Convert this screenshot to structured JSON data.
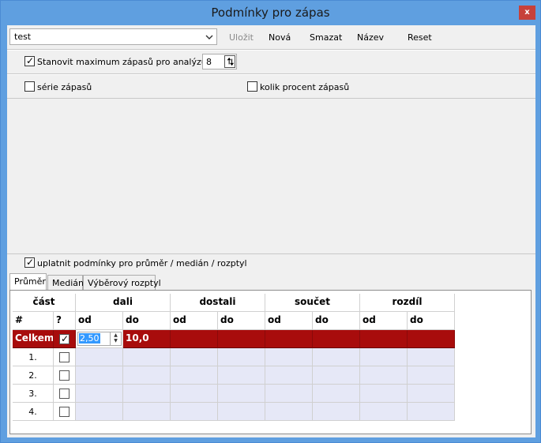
{
  "window": {
    "title": "Podmínky pro zápas",
    "close": "x"
  },
  "toolbar": {
    "combo_value": "test",
    "save": "Uložit",
    "new": "Nová",
    "delete": "Smazat",
    "name": "Název",
    "reset": "Reset"
  },
  "options": {
    "max_matches_label": "Stanovit maximum zápasů pro analýzu",
    "max_matches_checked": true,
    "max_matches_value": "8",
    "series_label": "série zápasů",
    "series_checked": false,
    "percent_label": "kolik procent zápasů",
    "percent_checked": false
  },
  "lower": {
    "apply_label": "uplatnit podmínky pro průměr / medián / rozptyl",
    "apply_checked": true,
    "tabs": [
      "Průměr",
      "Medián",
      "Výběrový rozptyl"
    ],
    "active_tab": "Průměr"
  },
  "grid": {
    "group_headers": [
      "část",
      "dali",
      "dostali",
      "součet",
      "rozdíl"
    ],
    "sub_headers": [
      "#",
      "?",
      "od",
      "do",
      "od",
      "do",
      "od",
      "do",
      "od",
      "do"
    ],
    "total_row": {
      "label": "Celkem",
      "checked": true,
      "od": "2,50",
      "do": "10,0"
    },
    "rows": [
      {
        "num": "1.",
        "checked": false
      },
      {
        "num": "2.",
        "checked": false
      },
      {
        "num": "3.",
        "checked": false
      },
      {
        "num": "4.",
        "checked": false
      }
    ]
  },
  "colors": {
    "title_bar": "#5f9fe0",
    "close": "#c7413a",
    "total_row": "#a80c0c",
    "data_row": "#e6e8f7"
  }
}
